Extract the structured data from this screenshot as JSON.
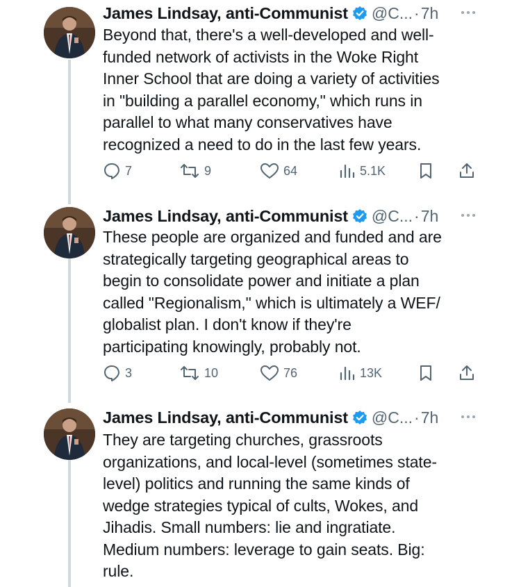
{
  "tweets": [
    {
      "name": "James Lindsay, anti-Communist",
      "handle": "@C...",
      "dot": "·",
      "time": "7h",
      "text": "Beyond that, there's a well-developed and well-\nfunded network of activists in the Woke Right\nInner School that are doing a variety of activities\nin \"building a parallel economy,\" which runs in\nparallel to what many conservatives have\nrecognized a need to do in the last few years.",
      "replies": "7",
      "reposts": "9",
      "likes": "64",
      "views": "5.1K"
    },
    {
      "name": "James Lindsay, anti-Communist",
      "handle": "@C...",
      "dot": "·",
      "time": "7h",
      "text": "These people are organized and funded and are\nstrategically targeting geographical areas to\nbegin to consolidate power and initiate a plan\ncalled \"Regionalism,\" which is ultimately a WEF/\nglobalist plan. I don't know if they're\nparticipating knowingly, probably not.",
      "replies": "3",
      "reposts": "10",
      "likes": "76",
      "views": "13K"
    },
    {
      "name": "James Lindsay, anti-Communist",
      "handle": "@C...",
      "dot": "·",
      "time": "7h",
      "text": "They are targeting churches, grassroots\norganizations, and local-level (sometimes state-\nlevel) politics and running the same kinds of\nwedge strategies typical of cults, Wokes, and\nJihadis. Small numbers: lie and ingratiate.\nMedium numbers: leverage to gain seats. Big:\nrule."
    }
  ],
  "icons": {
    "reply": "reply-icon",
    "repost": "repost-icon",
    "like": "heart-icon",
    "views": "views-icon",
    "bookmark": "bookmark-icon",
    "share": "share-icon",
    "verified": "verified-badge-icon",
    "more": "more-icon"
  },
  "colors": {
    "text": "#0f1419",
    "secondary": "#536471",
    "verified": "#1d9bf0",
    "thread_line": "#cfd9de"
  }
}
